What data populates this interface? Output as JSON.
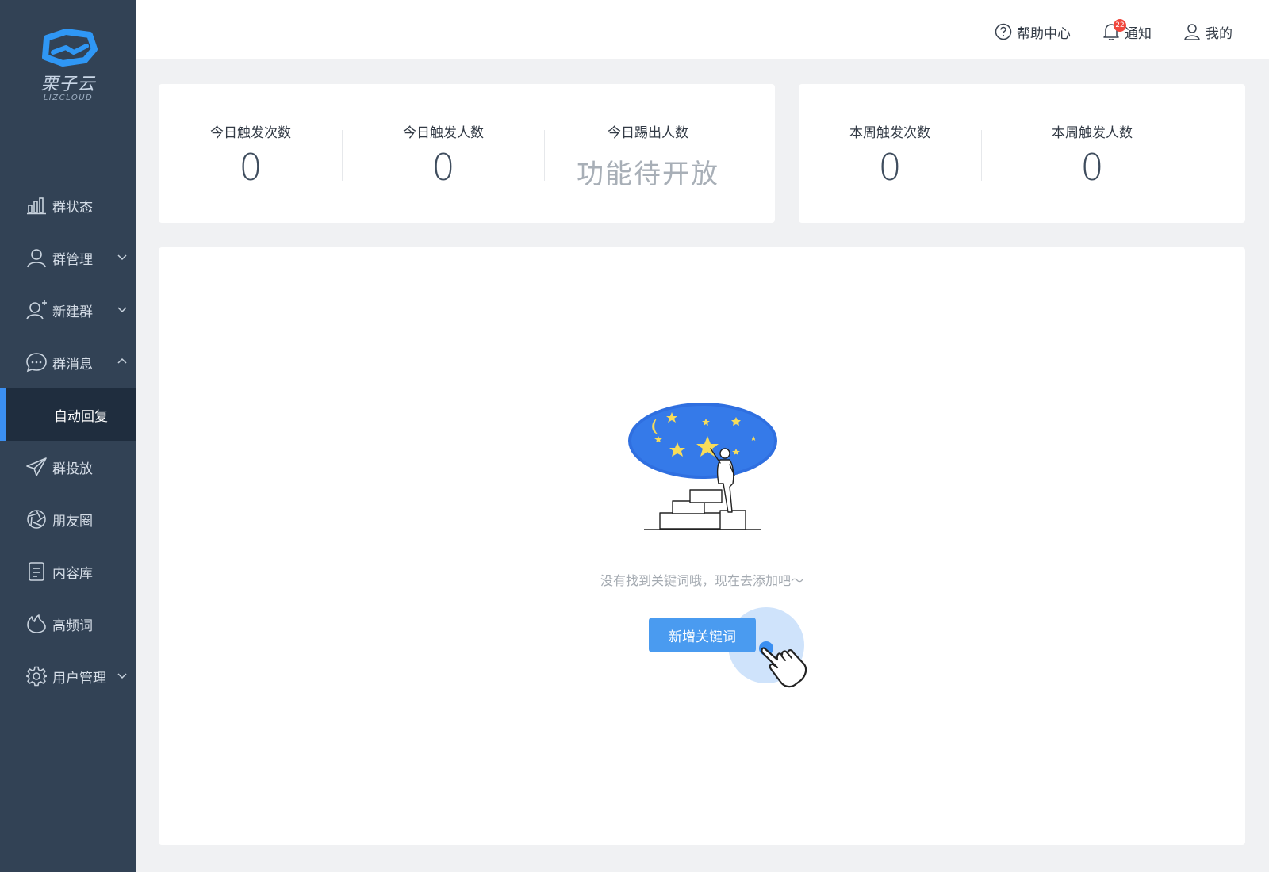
{
  "brand": {
    "name_cn": "栗子云",
    "name_en": "LIZCLOUD"
  },
  "sidebar": {
    "items": [
      {
        "label": "群状态",
        "icon": "bar-chart-icon",
        "expandable": false
      },
      {
        "label": "群管理",
        "icon": "user-icon",
        "expandable": true,
        "expanded": false
      },
      {
        "label": "新建群",
        "icon": "user-add-icon",
        "expandable": true,
        "expanded": false
      },
      {
        "label": "群消息",
        "icon": "chat-bubble-icon",
        "expandable": true,
        "expanded": true
      },
      {
        "label": "群投放",
        "icon": "send-icon",
        "expandable": false
      },
      {
        "label": "朋友圈",
        "icon": "aperture-icon",
        "expandable": false
      },
      {
        "label": "内容库",
        "icon": "document-icon",
        "expandable": false
      },
      {
        "label": "高频词",
        "icon": "flame-icon",
        "expandable": false
      },
      {
        "label": "用户管理",
        "icon": "gear-icon",
        "expandable": true,
        "expanded": false
      }
    ],
    "active_sub_item": "自动回复"
  },
  "header": {
    "help_label": "帮助中心",
    "notify_label": "通知",
    "notify_badge": "22",
    "mine_label": "我的"
  },
  "stats_today": [
    {
      "label": "今日触发次数",
      "value": "0"
    },
    {
      "label": "今日触发人数",
      "value": "0"
    },
    {
      "label": "今日踢出人数",
      "value": "功能待开放"
    }
  ],
  "stats_week": [
    {
      "label": "本周触发次数",
      "value": "0"
    },
    {
      "label": "本周触发人数",
      "value": "0"
    }
  ],
  "empty_state": {
    "message": "没有找到关键词哦，现在去添加吧～",
    "button_label": "新增关键词",
    "illustration": "starry-night-person-painting-stars"
  },
  "colors": {
    "sidebar_bg": "#324255",
    "sidebar_active_bg": "#1f2d3e",
    "accent": "#3b8ff1",
    "button": "#4a9bf0",
    "badge": "#f0473d"
  }
}
